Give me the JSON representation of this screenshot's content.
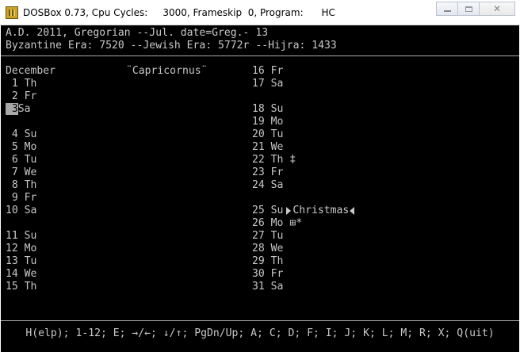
{
  "window": {
    "title": "DOSBox 0.73, Cpu Cycles:     3000, Frameskip  0, Program:      HC",
    "min_icon": "minimize-icon",
    "max_icon": "maximize-icon",
    "close_glyph": "✕"
  },
  "header": {
    "line1": "A.D. 2011, Gregorian --Jul. date=Greg.- 13",
    "line2": "Byzantine Era: 7520 --Jewish Era: 5772r --Hijra: 1433"
  },
  "calendar": {
    "month": "December",
    "sign": "¨Capricornus¨",
    "left": [
      {
        "day": " 1",
        "wd": "Th"
      },
      {
        "day": " 2",
        "wd": "Fr"
      },
      {
        "day": " 3",
        "wd": "Sa"
      },
      {
        "day": " 4",
        "wd": "Su"
      },
      {
        "day": " 5",
        "wd": "Mo"
      },
      {
        "day": " 6",
        "wd": "Tu"
      },
      {
        "day": " 7",
        "wd": "We"
      },
      {
        "day": " 8",
        "wd": "Th"
      },
      {
        "day": " 9",
        "wd": "Fr"
      },
      {
        "day": "10",
        "wd": "Sa"
      },
      {
        "day": "11",
        "wd": "Su"
      },
      {
        "day": "12",
        "wd": "Mo"
      },
      {
        "day": "13",
        "wd": "Tu"
      },
      {
        "day": "14",
        "wd": "We"
      },
      {
        "day": "15",
        "wd": "Th"
      }
    ],
    "right": [
      {
        "day": "16",
        "wd": "Fr",
        "mark": ""
      },
      {
        "day": "17",
        "wd": "Sa",
        "mark": ""
      },
      {
        "day": "18",
        "wd": "Su",
        "mark": ""
      },
      {
        "day": "19",
        "wd": "Mo",
        "mark": ""
      },
      {
        "day": "20",
        "wd": "Tu",
        "mark": ""
      },
      {
        "day": "21",
        "wd": "We",
        "mark": ""
      },
      {
        "day": "22",
        "wd": "Th",
        "mark": "‡"
      },
      {
        "day": "23",
        "wd": "Fr",
        "mark": ""
      },
      {
        "day": "24",
        "wd": "Sa",
        "mark": ""
      },
      {
        "day": "25",
        "wd": "Su",
        "mark": ""
      },
      {
        "day": "26",
        "wd": "Mo",
        "mark": "⊞*"
      },
      {
        "day": "27",
        "wd": "Tu",
        "mark": ""
      },
      {
        "day": "28",
        "wd": "We",
        "mark": ""
      },
      {
        "day": "29",
        "wd": "Th",
        "mark": ""
      },
      {
        "day": "30",
        "wd": "Fr",
        "mark": ""
      },
      {
        "day": "31",
        "wd": "Sa",
        "mark": ""
      }
    ],
    "holiday": "Christmas"
  },
  "status_bar": "H(elp); 1-12; E; →/←; ↓/↑; PgDn/Up; A; C; D; F; I; J; K; L; M; R; X; Q(uit)"
}
